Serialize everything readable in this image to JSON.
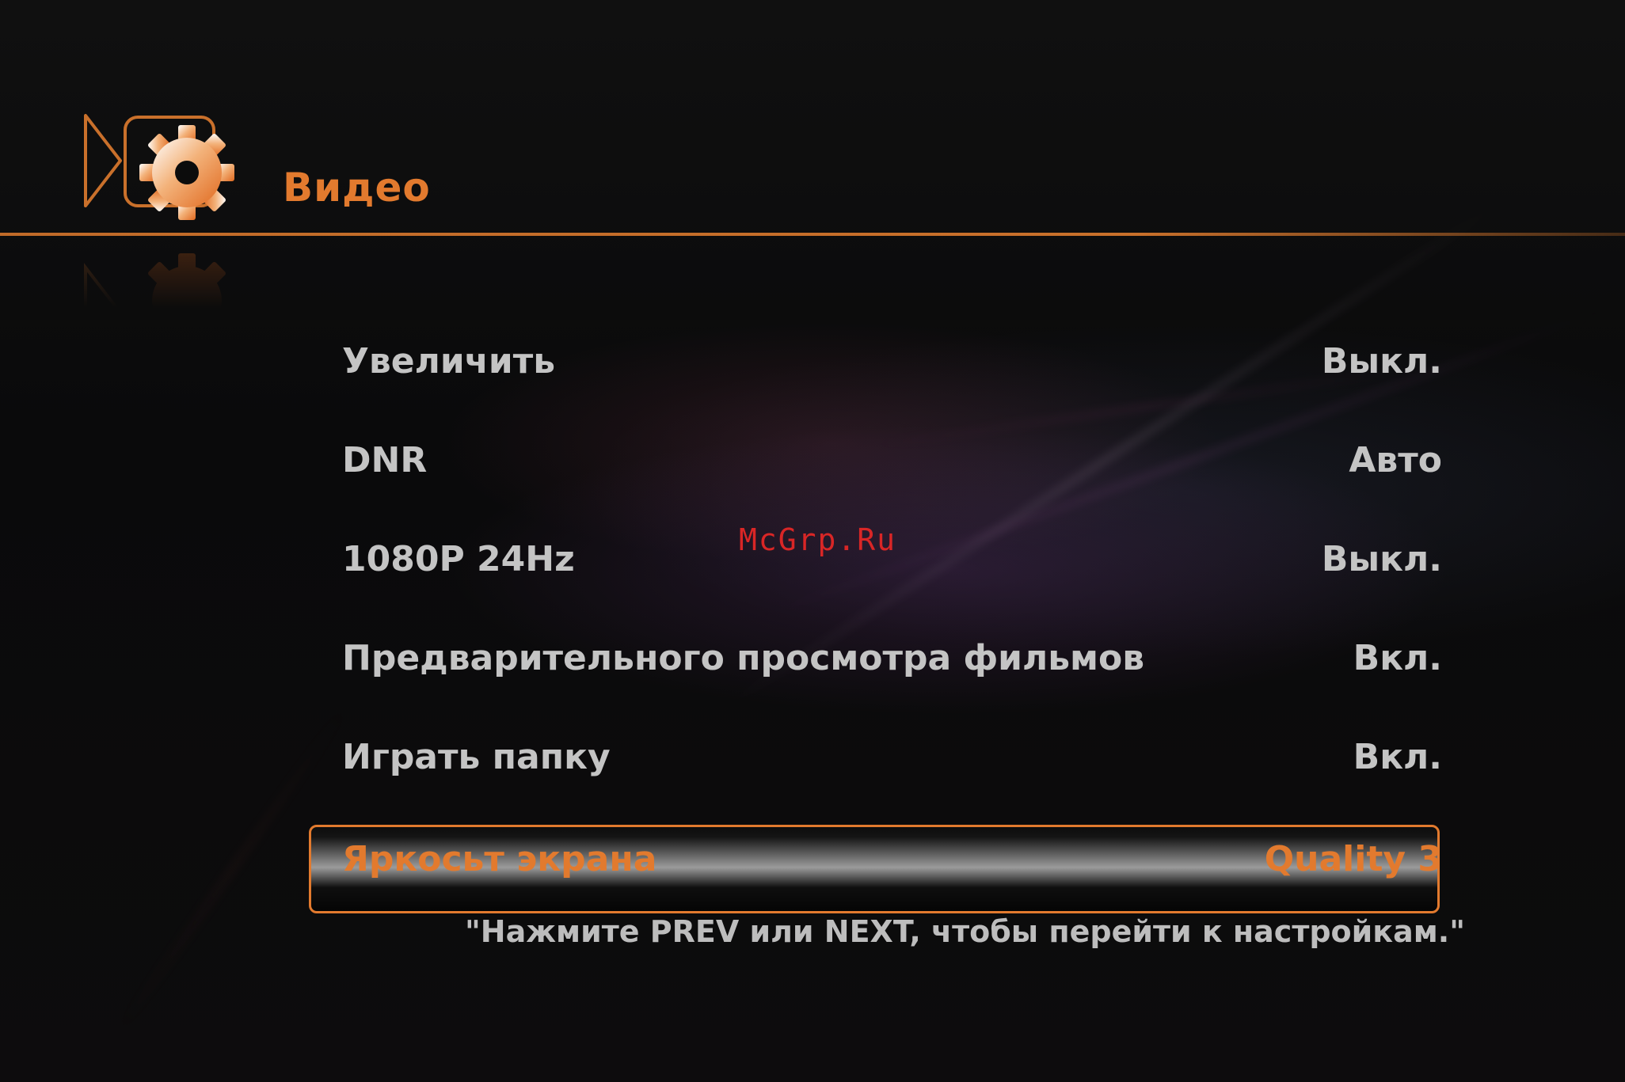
{
  "header": {
    "icon": "video-settings-gear-icon",
    "title": "Видео"
  },
  "settings": [
    {
      "label": "Увеличить",
      "value": "Выкл."
    },
    {
      "label": "DNR",
      "value": "Авто"
    },
    {
      "label": "1080P 24Hz",
      "value": "Выкл."
    },
    {
      "label": "Предварительного просмотра фильмов",
      "value": "Вкл."
    },
    {
      "label": "Играть папку",
      "value": "Вкл."
    },
    {
      "label": "Яркосьт экрана",
      "value": "Quality 3",
      "selected": true
    }
  ],
  "hint": "\"Нажмите PREV или NEXT, чтобы перейти к настройкам.\"",
  "watermark": "McGrp.Ru",
  "colors": {
    "accent": "#e27a2e",
    "text": "#c4c4c4",
    "background": "#0b0b0c",
    "watermark": "#d92626"
  }
}
